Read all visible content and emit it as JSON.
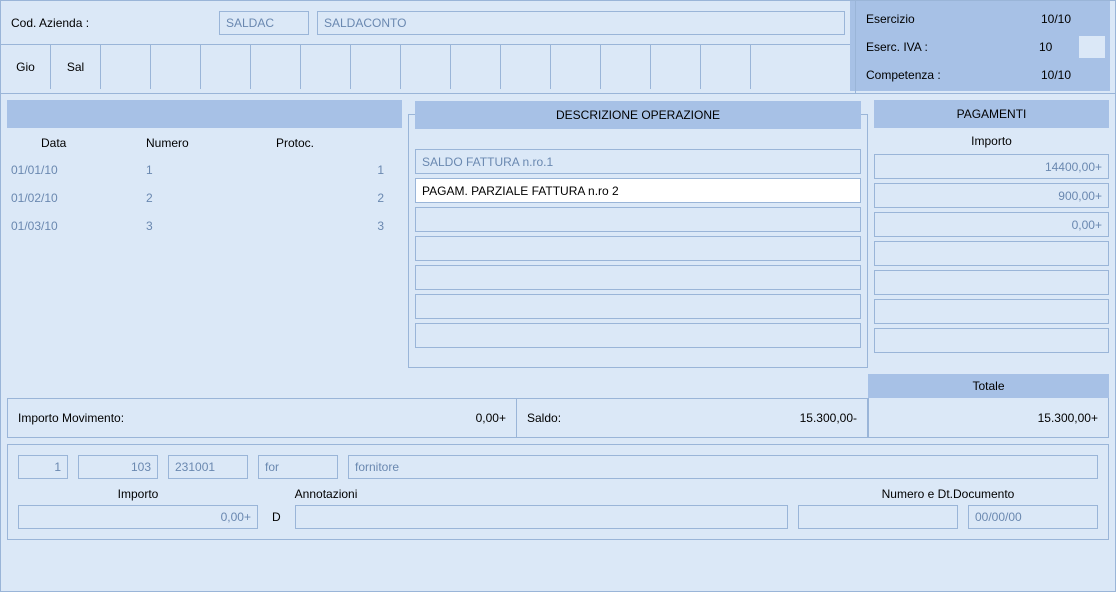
{
  "header": {
    "cod_label": "Cod. Azienda :",
    "cod_code": "SALDAC",
    "cod_desc": "SALDACONTO",
    "tabs": [
      "Gio",
      "Sal",
      "",
      "",
      "",
      "",
      "",
      "",
      "",
      "",
      "",
      "",
      "",
      "",
      "",
      ""
    ]
  },
  "exercise": {
    "esercizio_label": "Esercizio",
    "esercizio_val": "10/10",
    "eserc_iva_label": "Eserc. IVA :",
    "eserc_iva_val": "10",
    "competenza_label": "Competenza :",
    "competenza_val": "10/10"
  },
  "left_table": {
    "headers": {
      "data": "Data",
      "numero": "Numero",
      "protoc": "Protoc."
    },
    "rows": [
      {
        "data": "01/01/10",
        "numero": "1",
        "protoc": "1"
      },
      {
        "data": "01/02/10",
        "numero": "2",
        "protoc": "2"
      },
      {
        "data": "01/03/10",
        "numero": "3",
        "protoc": "3"
      }
    ]
  },
  "descrizione": {
    "title": "DESCRIZIONE OPERAZIONE",
    "lines": [
      "SALDO FATTURA n.ro.1",
      "PAGAM. PARZIALE FATTURA n.ro 2",
      "",
      "",
      "",
      "",
      ""
    ],
    "active_index": 1
  },
  "pagamenti": {
    "title": "PAGAMENTI",
    "importo_label": "Importo",
    "lines": [
      "14400,00+",
      "900,00+",
      "0,00+",
      "",
      "",
      "",
      ""
    ]
  },
  "totals": {
    "importo_mov_label": "Importo Movimento:",
    "importo_mov_val": "0,00+",
    "saldo_label": "Saldo:",
    "saldo_val": "15.300,00-",
    "totale_label": "Totale",
    "totale_val": "15.300,00+"
  },
  "bottom": {
    "f1": "1",
    "f2": "103",
    "f3": "231001",
    "f4": "for",
    "f5": "fornitore",
    "importo_label": "Importo",
    "importo_val": "0,00+",
    "d_label": "D",
    "annot_label": "Annotazioni",
    "annot_val": "",
    "numdt_label": "Numero e Dt.Documento",
    "num_val": "",
    "dt_val": "00/00/00"
  }
}
